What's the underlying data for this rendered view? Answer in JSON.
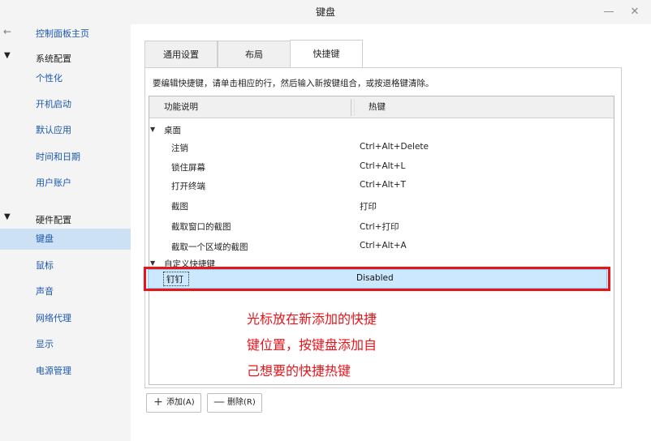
{
  "window": {
    "title": "键盘",
    "minimize_symbol": "—",
    "close_symbol": "✕"
  },
  "sidebar": {
    "home_label": "控制面板主页",
    "back_icon": "←",
    "groups": [
      {
        "label": "系统配置",
        "arrow": "▼",
        "items": [
          "个性化",
          "开机启动",
          "默认应用",
          "时间和日期",
          "用户账户"
        ]
      },
      {
        "label": "硬件配置",
        "arrow": "▼",
        "items": [
          "键盘",
          "鼠标",
          "声音",
          "网络代理",
          "显示",
          "电源管理"
        ]
      }
    ],
    "active_item": "键盘"
  },
  "tabs": [
    {
      "label": "通用设置",
      "active": false
    },
    {
      "label": "布局",
      "active": false
    },
    {
      "label": "快捷键",
      "active": true
    }
  ],
  "hint_text": "要编辑快捷键，请单击相应的行，然后输入新按键组合，或按退格键清除。",
  "table": {
    "headers": [
      "功能说明",
      "热键"
    ],
    "categories": [
      {
        "label": "桌面",
        "arrow": "▼",
        "rows": [
          {
            "func": "注销",
            "key": "Ctrl+Alt+Delete"
          },
          {
            "func": "锁住屏幕",
            "key": "Ctrl+Alt+L"
          },
          {
            "func": "打开终端",
            "key": "Ctrl+Alt+T"
          },
          {
            "func": "截图",
            "key": "打印"
          },
          {
            "func": "截取窗口的截图",
            "key": "Ctrl+打印"
          },
          {
            "func": "截取一个区域的截图",
            "key": "Ctrl+Alt+A"
          }
        ]
      },
      {
        "label": "自定义快捷键",
        "arrow": "▼",
        "rows": [
          {
            "func": "钉钉",
            "key": "Disabled",
            "selected": true
          }
        ]
      }
    ]
  },
  "annotation_lines": [
    "光标放在新添加的快捷",
    "键位置，按键盘添加自",
    "己想要的快捷热键"
  ],
  "annotation_color": "#e8141a",
  "buttons": {
    "add_label": "添加(A)",
    "add_icon": "+",
    "delete_label": "删除(R)",
    "delete_icon": "—"
  },
  "colors": {
    "link": "#1a56b0",
    "selection": "#cce8ff",
    "sidebar_active": "#cde1f5"
  }
}
